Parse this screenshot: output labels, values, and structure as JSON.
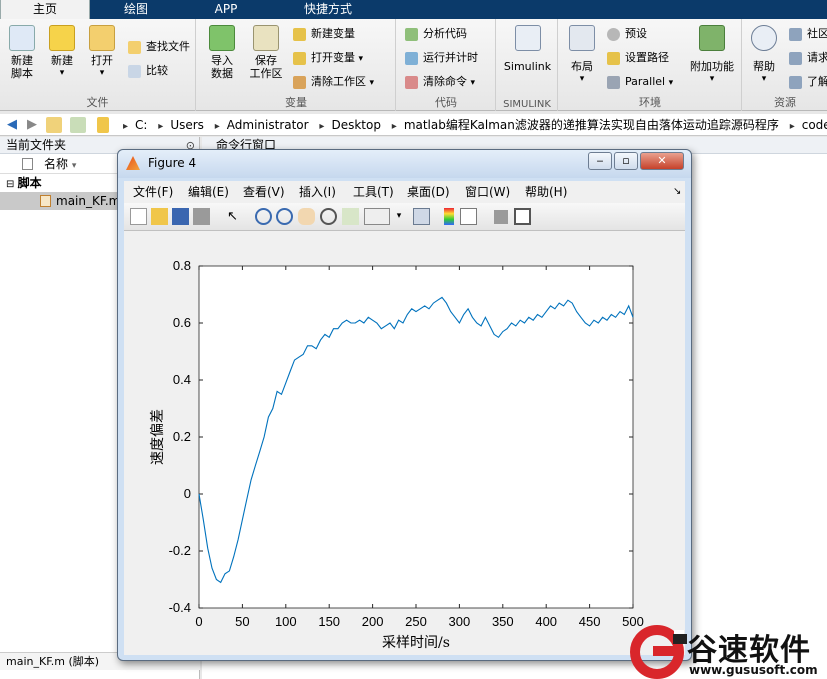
{
  "tabs": [
    "主页",
    "绘图",
    "APP",
    "快捷方式"
  ],
  "ribbon": {
    "file": {
      "label": "文件",
      "new_script": [
        "新建",
        "脚本"
      ],
      "new": "新建",
      "open": "打开",
      "find_files": "查找文件",
      "compare": "比较"
    },
    "variable": {
      "label": "变量",
      "import": [
        "导入",
        "数据"
      ],
      "save": [
        "保存",
        "工作区"
      ],
      "new_var": "新建变量",
      "open_var": "打开变量",
      "clear_ws": "清除工作区"
    },
    "code": {
      "label": "代码",
      "analyze": "分析代码",
      "run_time": "运行并计时",
      "clear_cmd": "清除命令"
    },
    "simulink": {
      "label": "SIMULINK",
      "btn": "Simulink"
    },
    "env": {
      "label": "环境",
      "layout": "布局",
      "prefs": "预设",
      "set_path": "设置路径",
      "parallel": "Parallel",
      "addons": "附加功能"
    },
    "resources": {
      "label": "资源",
      "help": "帮助",
      "community": "社区",
      "request": "请求",
      "learn": "了解"
    }
  },
  "path": [
    "C:",
    "Users",
    "Administrator",
    "Desktop",
    "matlab编程Kalman滤波器的递推算法实现自由落体运动追踪源码程序",
    "code"
  ],
  "left": {
    "title": "当前文件夹",
    "col_name": "名称",
    "group": "脚本",
    "file": "main_KF.m",
    "status": "main_KF.m  (脚本)"
  },
  "cmd_title": "命令行窗口",
  "figure": {
    "title": "Figure 4",
    "menu": [
      "文件(F)",
      "编辑(E)",
      "查看(V)",
      "插入(I)",
      "工具(T)",
      "桌面(D)",
      "窗口(W)",
      "帮助(H)"
    ]
  },
  "watermark": {
    "brand": "谷速软件",
    "url": "www.gususoft.com"
  },
  "chart_data": {
    "type": "line",
    "xlabel": "采样时间/s",
    "ylabel": "速度偏差",
    "xlim": [
      0,
      500
    ],
    "ylim": [
      -0.4,
      0.8
    ],
    "xticks": [
      0,
      50,
      100,
      150,
      200,
      250,
      300,
      350,
      400,
      450,
      500
    ],
    "yticks": [
      -0.4,
      -0.2,
      0,
      0.2,
      0.4,
      0.6,
      0.8
    ],
    "grid": false,
    "color": "#0072bd",
    "series": [
      {
        "x": [
          0,
          5,
          10,
          15,
          20,
          25,
          30,
          35,
          40,
          45,
          50,
          55,
          60,
          65,
          70,
          75,
          80,
          85,
          90,
          95,
          100,
          105,
          110,
          115,
          120,
          125,
          130,
          135,
          140,
          145,
          150,
          155,
          160,
          165,
          170,
          175,
          180,
          185,
          190,
          195,
          200,
          205,
          210,
          215,
          220,
          225,
          230,
          235,
          240,
          245,
          250,
          255,
          260,
          265,
          270,
          275,
          280,
          285,
          290,
          295,
          300,
          305,
          310,
          315,
          320,
          325,
          330,
          335,
          340,
          345,
          350,
          355,
          360,
          365,
          370,
          375,
          380,
          385,
          390,
          395,
          400,
          405,
          410,
          415,
          420,
          425,
          430,
          435,
          440,
          445,
          450,
          455,
          460,
          465,
          470,
          475,
          480,
          485,
          490,
          495,
          500
        ],
        "y": [
          0.0,
          -0.09,
          -0.19,
          -0.26,
          -0.3,
          -0.31,
          -0.28,
          -0.27,
          -0.22,
          -0.16,
          -0.09,
          -0.02,
          0.05,
          0.1,
          0.15,
          0.2,
          0.27,
          0.3,
          0.36,
          0.35,
          0.39,
          0.43,
          0.47,
          0.48,
          0.49,
          0.52,
          0.52,
          0.51,
          0.54,
          0.56,
          0.55,
          0.58,
          0.58,
          0.6,
          0.61,
          0.6,
          0.6,
          0.61,
          0.6,
          0.62,
          0.61,
          0.6,
          0.58,
          0.59,
          0.6,
          0.58,
          0.61,
          0.6,
          0.63,
          0.65,
          0.64,
          0.65,
          0.66,
          0.65,
          0.67,
          0.68,
          0.69,
          0.67,
          0.64,
          0.62,
          0.6,
          0.63,
          0.65,
          0.62,
          0.6,
          0.59,
          0.62,
          0.59,
          0.56,
          0.55,
          0.57,
          0.58,
          0.6,
          0.59,
          0.61,
          0.6,
          0.62,
          0.61,
          0.63,
          0.62,
          0.64,
          0.66,
          0.65,
          0.67,
          0.66,
          0.68,
          0.67,
          0.64,
          0.62,
          0.6,
          0.59,
          0.61,
          0.6,
          0.62,
          0.61,
          0.63,
          0.62,
          0.64,
          0.63,
          0.66,
          0.62
        ]
      }
    ]
  }
}
